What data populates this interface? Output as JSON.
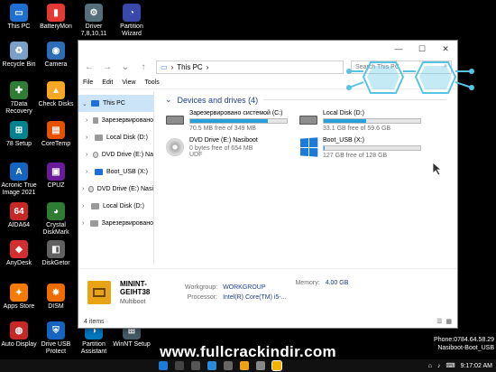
{
  "desktop": {
    "icons": [
      {
        "label": "This PC",
        "color": "#1f6fd0"
      },
      {
        "label": "BatteryMon",
        "color": "#e53935"
      },
      {
        "label": "Driver\n7,8,10,11",
        "color": "#546e7a"
      },
      {
        "label": "Partition\nWizard",
        "color": "#3949ab"
      },
      {
        "label": "Recycle Bin",
        "color": "#7aa0c8"
      },
      {
        "label": "Camera",
        "color": "#2d6db5"
      },
      {
        "label": "7Data\nRecovery",
        "color": "#2e7d32"
      },
      {
        "label": "Check Disks",
        "color": "#f9a825"
      },
      {
        "label": "78 Setup",
        "color": "#00838f"
      },
      {
        "label": "CoreTemp",
        "color": "#e65100"
      },
      {
        "label": "Acronic True\nImage 2021",
        "color": "#1565c0"
      },
      {
        "label": "CPUZ",
        "color": "#6a1b9a"
      },
      {
        "label": "AIDA64",
        "color": "#c62828"
      },
      {
        "label": "Crystal\nDiskMark",
        "color": "#2e7d32"
      },
      {
        "label": "AnyDesk",
        "color": "#d32f2f"
      },
      {
        "label": "DiskGetor",
        "color": "#616161"
      },
      {
        "label": "Apps Store",
        "color": "#f57c00"
      },
      {
        "label": "DISM",
        "color": "#ef6c00"
      },
      {
        "label": "Auto Display",
        "color": "#c62828"
      },
      {
        "label": "Drive USB\nProtect",
        "color": "#1565c0"
      },
      {
        "label": "Partition\nAssistant",
        "color": "#0277bd"
      },
      {
        "label": "WinNT Setup",
        "color": "#455a64"
      }
    ]
  },
  "window": {
    "title_buttons": [
      "—",
      "☐",
      "✕"
    ],
    "address": {
      "location": "This PC",
      "sep": "›"
    },
    "search_placeholder": "Search This PC",
    "menu": [
      "File",
      "Edit",
      "View",
      "Tools"
    ],
    "nav": [
      {
        "label": "This PC",
        "selected": true
      },
      {
        "label": "Зарезервировано"
      },
      {
        "label": "Local Disk (D:)"
      },
      {
        "label": "DVD Drive (E:) Na"
      },
      {
        "label": "Boot_USB (X:)"
      },
      {
        "label": "DVD Drive (E:) Nasi"
      },
      {
        "label": "Local Disk (D:)"
      },
      {
        "label": "Зарезервировано"
      }
    ],
    "section_title": "Devices and drives (4)",
    "drives": [
      {
        "name": "Зарезервировано системой (C:)",
        "sub": "70.5 MB free of 349 MB",
        "used_pct": 80
      },
      {
        "name": "Local Disk (D:)",
        "sub": "33.1 GB free of 59.6 GB",
        "used_pct": 44
      },
      {
        "name": "DVD Drive (E:) Nasiboot",
        "sub": "0 bytes free of 654 MB",
        "sub2": "UDF",
        "used_pct": 0
      },
      {
        "name": "Boot_USB (X:)",
        "sub": "127 GB free of 128 GB",
        "used_pct": 1
      }
    ],
    "details": {
      "name": "MININT-GEIHT38",
      "sub": "Multiboot",
      "workgroup_label": "Workgroup:",
      "workgroup": "WORKGROUP",
      "memory_label": "Memory:",
      "memory": "4.00 GB",
      "processor_label": "Processor:",
      "processor": "Intel(R) Core(TM) i5-..."
    },
    "status": "4 items"
  },
  "watermark": "www.fullcrackindir.com",
  "sysinfo": [
    "Phone:0784.64.58.29",
    "Nasiboot-Boot_USB"
  ],
  "clock": "9:17:02 AM",
  "colors": {
    "accent": "#26a0da",
    "logo_cyan": "#57c4e5"
  }
}
